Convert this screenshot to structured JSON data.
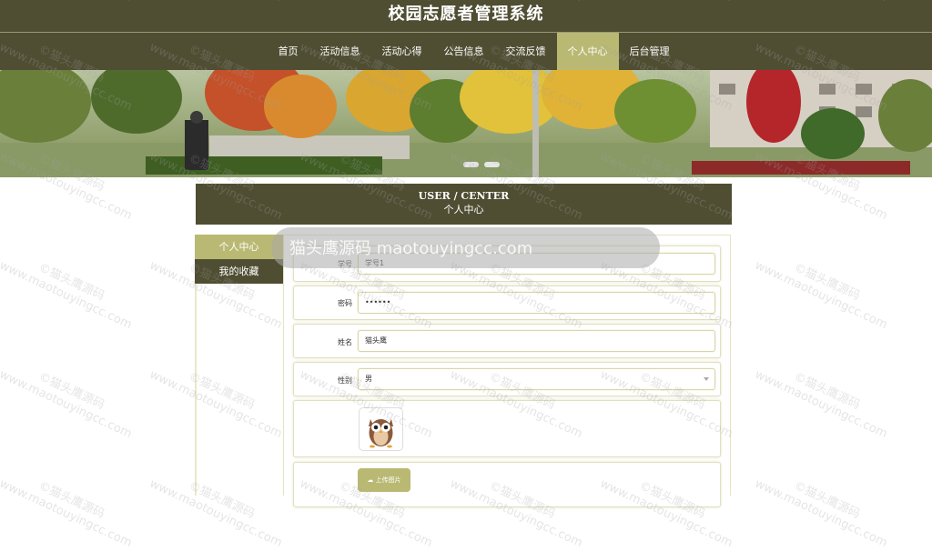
{
  "header": {
    "site_title": "校园志愿者管理系统"
  },
  "nav": {
    "items": [
      {
        "label": "首页",
        "active": false
      },
      {
        "label": "活动信息",
        "active": false
      },
      {
        "label": "活动心得",
        "active": false
      },
      {
        "label": "公告信息",
        "active": false
      },
      {
        "label": "交流反馈",
        "active": false
      },
      {
        "label": "个人中心",
        "active": true
      },
      {
        "label": "后台管理",
        "active": false
      }
    ]
  },
  "page_title": {
    "en": "USER / CENTER",
    "zh": "个人中心"
  },
  "side_menu": {
    "items": [
      {
        "label": "个人中心",
        "active": true
      },
      {
        "label": "我的收藏",
        "active": false
      }
    ]
  },
  "form": {
    "student_id": {
      "label": "学号",
      "value": "学号1"
    },
    "password": {
      "label": "密码",
      "value": "••••••"
    },
    "name": {
      "label": "姓名",
      "value": "猫头鹰"
    },
    "gender": {
      "label": "性别",
      "value": "男"
    },
    "avatar_icon": "owl-avatar-icon",
    "upload_label": "上传图片",
    "upload_icon": "cloud-upload-icon"
  },
  "overlay": {
    "text": "猫头鹰源码 maotouyingcc.com"
  },
  "watermark": {
    "line1": "©猫头鹰源码",
    "line2": "www.maotouyingcc.com"
  },
  "colors": {
    "header_bg": "#4f4e33",
    "accent": "#b9b973"
  }
}
